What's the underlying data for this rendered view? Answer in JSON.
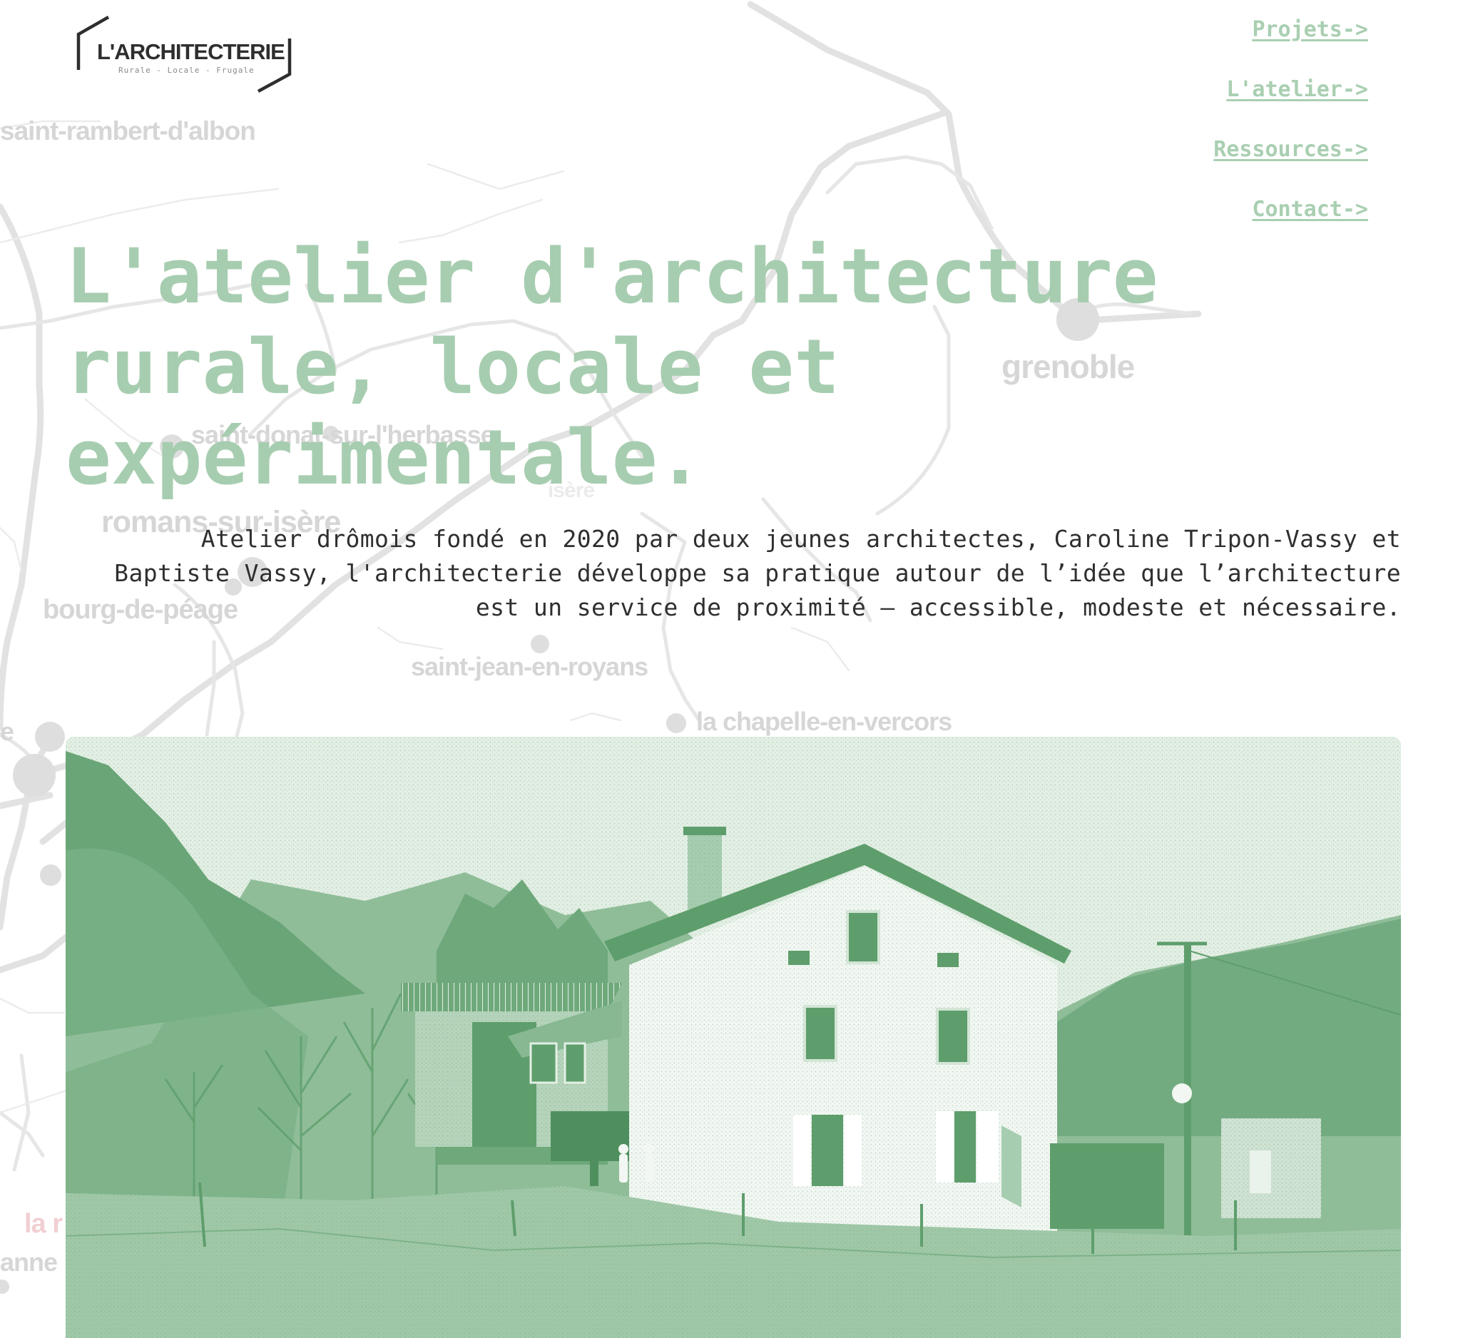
{
  "logo": {
    "name": "L'ARCHITECTERIE",
    "tagline": "Rurale - Locale - Frugale"
  },
  "nav": {
    "items": [
      {
        "label": "Projets->"
      },
      {
        "label": "L'atelier->"
      },
      {
        "label": "Ressources->"
      },
      {
        "label": "Contact->"
      }
    ]
  },
  "hero": {
    "title": "L'atelier d'architecture rurale, locale et expérimentale.",
    "intro": "Atelier drômois fondé en 2020 par deux jeunes architectes, Caroline Tripon-Vassy et Baptiste Vassy, l'architecterie développe sa pratique autour de l’idée que l’architecture est un service de proximité — accessible, modeste et nécessaire."
  },
  "map": {
    "places": [
      "saint-rambert-d'albon",
      "grenoble",
      "saint-donat-sur-l'herbasse",
      "isère",
      "romans-sur-isère",
      "bourg-de-péage",
      "saint-jean-en-royans",
      "la chapelle-en-vercors",
      "la r",
      "anne",
      "e"
    ]
  },
  "colors": {
    "accent_green": "#a7cdb0",
    "photo_green": "#5e9e6c",
    "text": "#2f2f2f",
    "map_line": "#e2e2e2"
  }
}
